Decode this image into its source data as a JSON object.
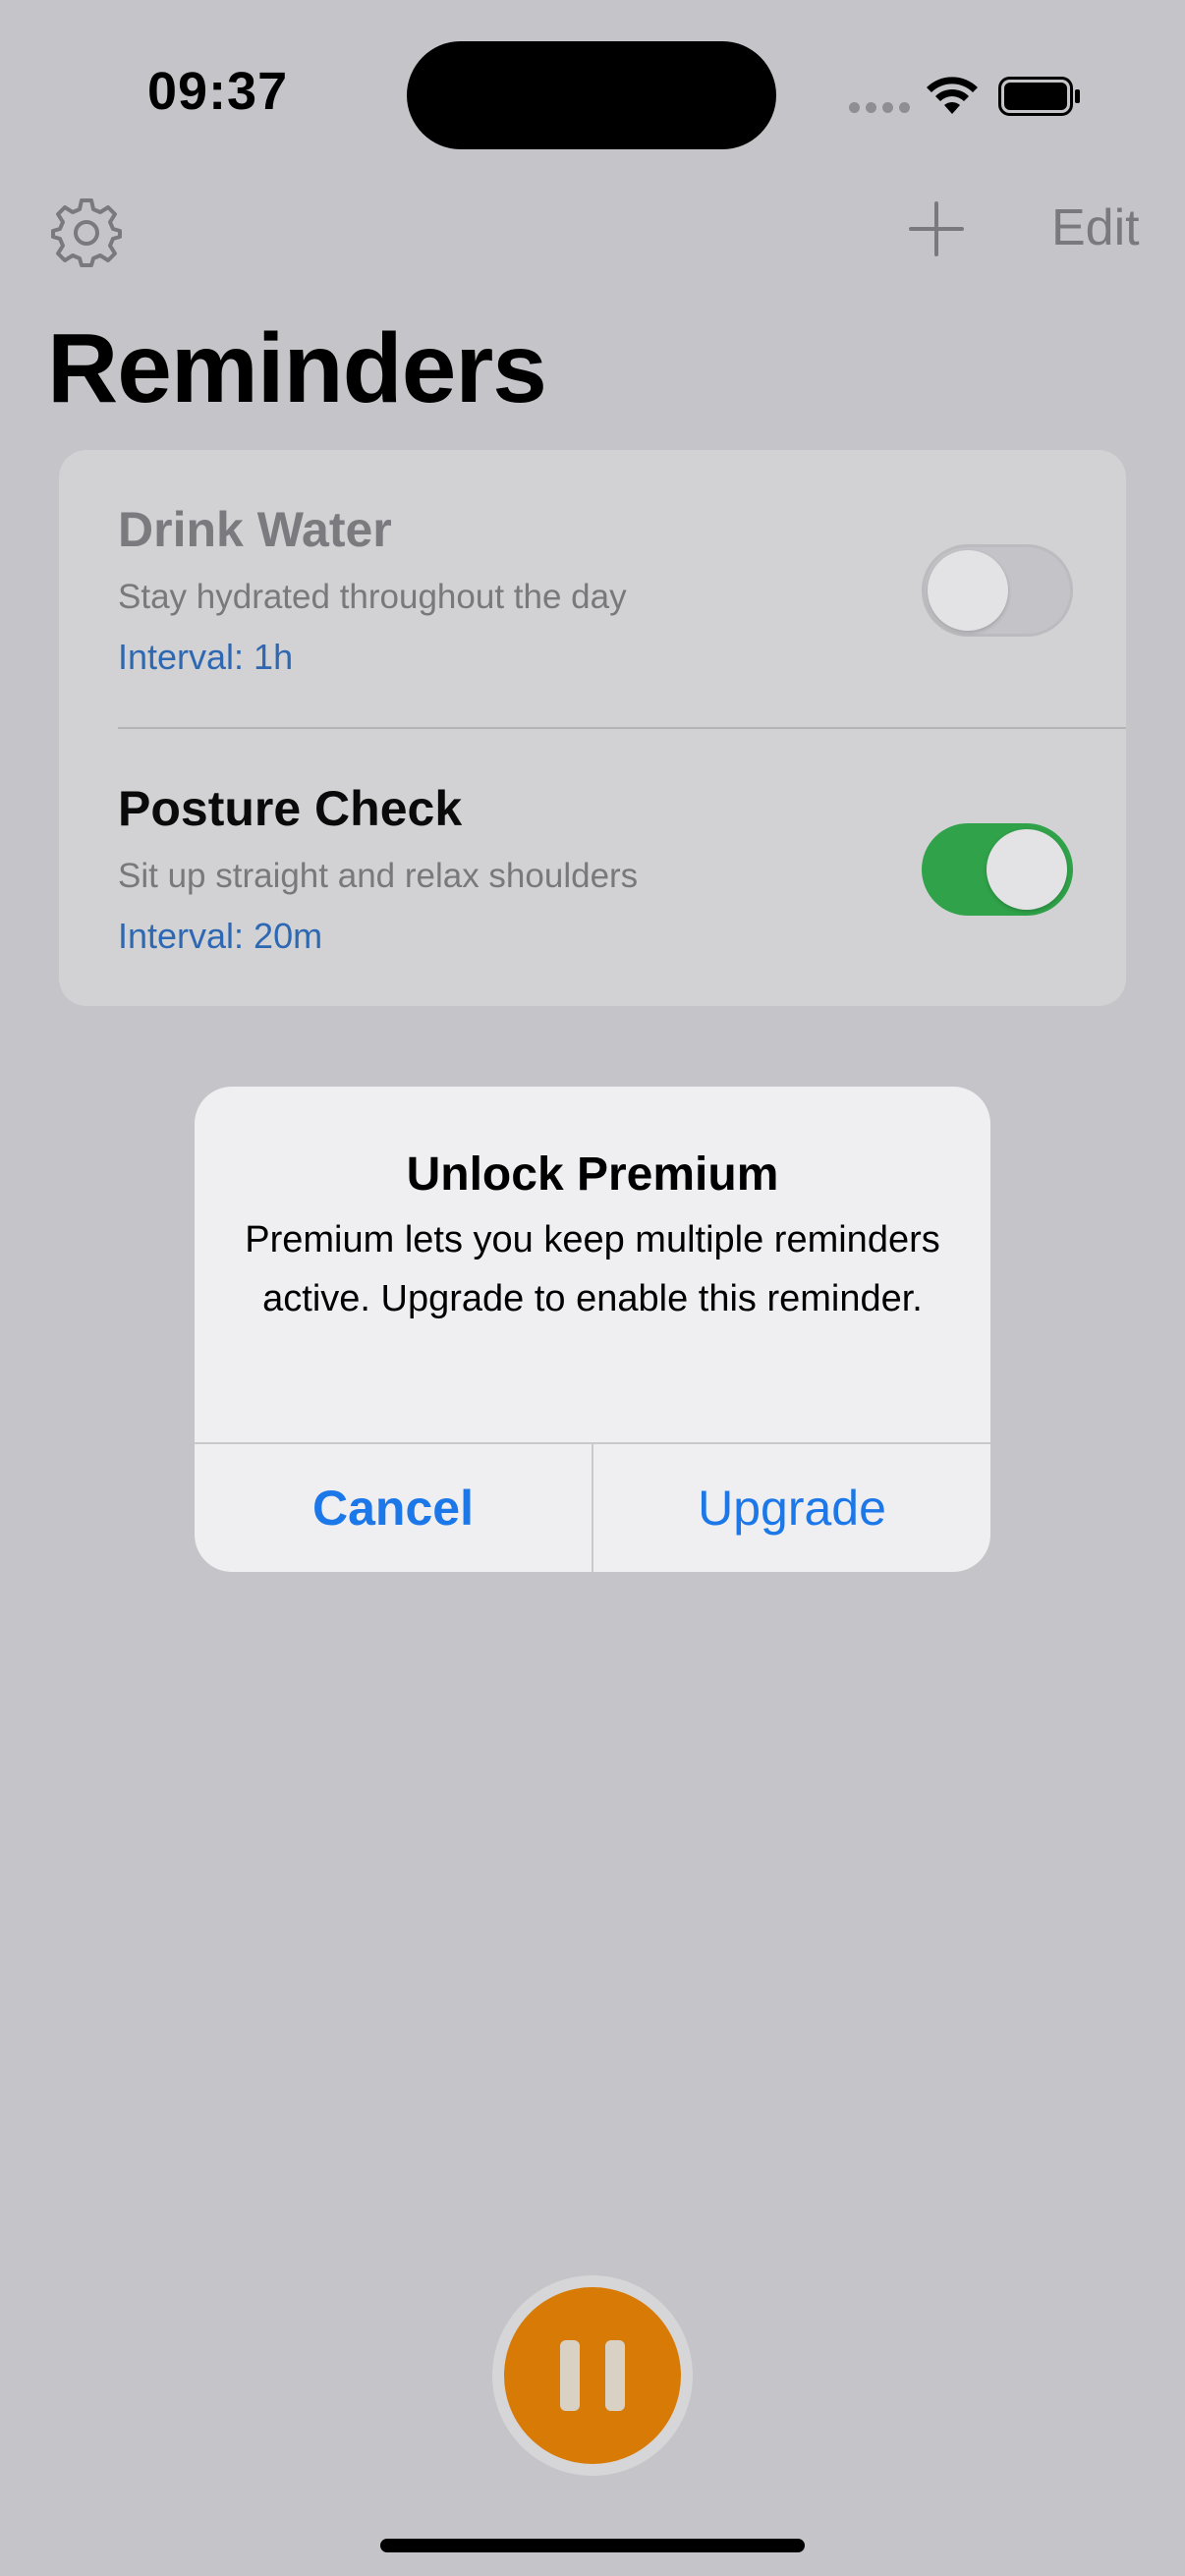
{
  "status_bar": {
    "time": "09:37"
  },
  "nav": {
    "settings_icon": "gear-icon",
    "add_icon": "plus-icon",
    "edit_label": "Edit"
  },
  "title": "Reminders",
  "reminders": [
    {
      "title": "Drink Water",
      "subtitle": "Stay hydrated throughout the day",
      "interval": "Interval: 1h",
      "enabled": false
    },
    {
      "title": "Posture Check",
      "subtitle": "Sit up straight and relax shoulders",
      "interval": "Interval: 20m",
      "enabled": true
    }
  ],
  "alert": {
    "title": "Unlock Premium",
    "message": "Premium lets you keep multiple reminders active. Upgrade to enable this reminder.",
    "cancel_label": "Cancel",
    "upgrade_label": "Upgrade"
  },
  "fab": {
    "icon": "pause-icon"
  },
  "colors": {
    "accent": "#1c77e8",
    "toggle_on": "#30a24a",
    "fab": "#d77b06",
    "interval_text": "#2e68b3"
  }
}
